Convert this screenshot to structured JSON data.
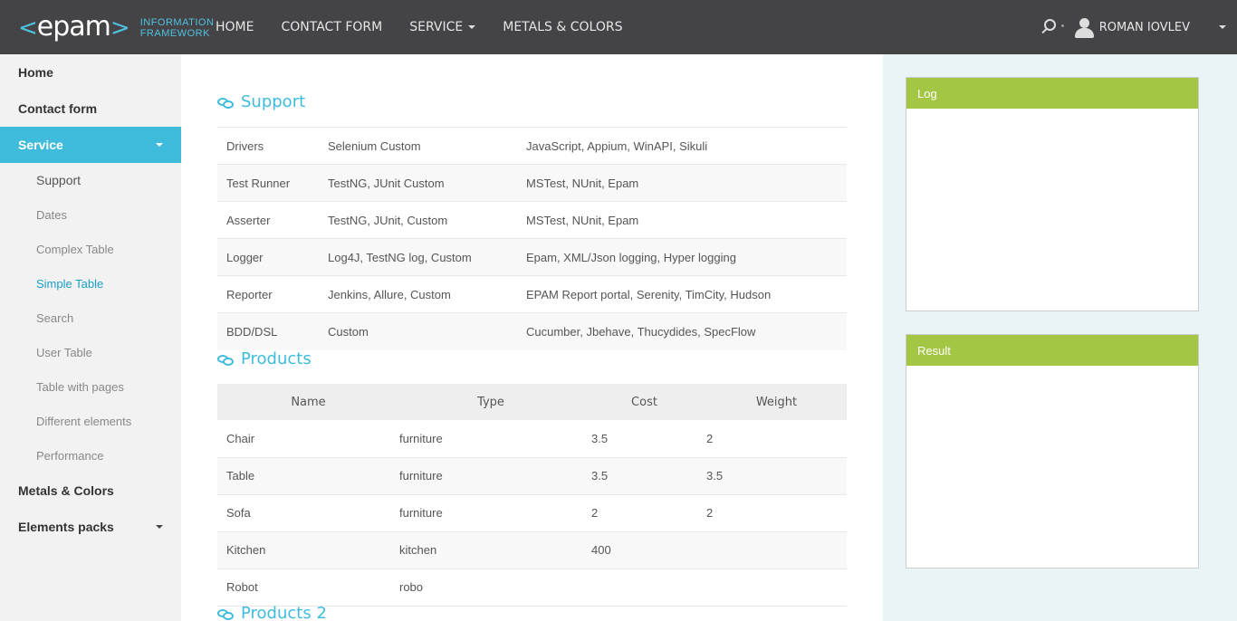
{
  "header": {
    "logo": "epam",
    "logo_sub_1": "INFORMATION",
    "logo_sub_2": "FRAMEWORK",
    "nav": [
      "HOME",
      "CONTACT FORM",
      "SERVICE",
      "METALS & COLORS"
    ],
    "user_name": "ROMAN IOVLEV"
  },
  "sidebar": {
    "home": "Home",
    "contact_form": "Contact form",
    "service": "Service",
    "sub_items": [
      "Support",
      "Dates",
      "Complex Table",
      "Simple Table",
      "Search",
      "User Table",
      "Table with pages",
      "Different elements",
      "Performance"
    ],
    "metals_colors": "Metals & Colors",
    "elements_packs": "Elements packs"
  },
  "support": {
    "title": "Support",
    "rows": [
      [
        "Drivers",
        "Selenium Custom",
        "JavaScript, Appium, WinAPI, Sikuli"
      ],
      [
        "Test Runner",
        "TestNG, JUnit Custom",
        "MSTest, NUnit, Epam"
      ],
      [
        "Asserter",
        "TestNG, JUnit, Custom",
        "MSTest, NUnit, Epam"
      ],
      [
        "Logger",
        "Log4J, TestNG log, Custom",
        "Epam, XML/Json logging, Hyper logging"
      ],
      [
        "Reporter",
        "Jenkins, Allure, Custom",
        "EPAM Report portal, Serenity, TimCity, Hudson"
      ],
      [
        "BDD/DSL",
        "Custom",
        "Cucumber, Jbehave, Thucydides, SpecFlow"
      ]
    ]
  },
  "products": {
    "title": "Products",
    "headers": [
      "Name",
      "Type",
      "Cost",
      "Weight"
    ],
    "rows": [
      [
        "Chair",
        "furniture",
        "3.5",
        "2"
      ],
      [
        "Table",
        "furniture",
        "3.5",
        "3.5"
      ],
      [
        "Sofa",
        "furniture",
        "2",
        "2"
      ],
      [
        "Kitchen",
        "kitchen",
        "400",
        ""
      ],
      [
        "Robot",
        "robo",
        "",
        ""
      ]
    ]
  },
  "products2": {
    "title": "Products 2"
  },
  "log_panel": {
    "title": "Log"
  },
  "result_panel": {
    "title": "Result"
  },
  "colors": {
    "header_bg": "#444447",
    "accent": "#3fbcdc",
    "panel_head": "#a3c644",
    "right_bg": "#e9f4f6"
  }
}
